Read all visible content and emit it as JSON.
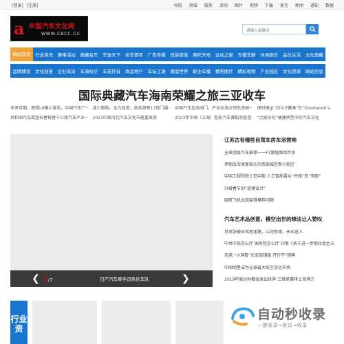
{
  "topbar": {
    "left": [
      "[登录]",
      "[注册]"
    ],
    "right": [
      "导航",
      "商城",
      "服务",
      "活动",
      "图片",
      "视频",
      "下载",
      "留言",
      "新闻",
      "通知",
      "数据"
    ]
  },
  "logo": {
    "title": "中国汽车文化网",
    "url": "WWW.CBCC.CC"
  },
  "search": {
    "placeholder": "请输入关键词"
  },
  "nav_row1": [
    "网站首页",
    "行业资讯",
    "赛事活动",
    "典藏名车",
    "车迷天下",
    "名车荟萃",
    "广告传媒",
    "改装部落",
    "摩托天地",
    "运动之窗",
    "车模艺廊",
    "休闲娱乐",
    "品位生活",
    "文化典藏"
  ],
  "nav_row2": [
    "品牌博览",
    "文化创意",
    "企业风采",
    "车海拾贝",
    "车苑铃音",
    "商品地产",
    "车坛江湖",
    "模型世界",
    "职业车模",
    "精美图片",
    "精彩视频",
    "产业园区",
    "文化资源",
    "网站信息"
  ],
  "headline": "国际典藏汽车海南荣耀之旅三亚收车",
  "sub_links": [
    "未来可期，理想L9爆火背后，中国汽车厂一",
    "减少限购，全力促进，商务部等17部门通一",
    "中国汽车走出国门，产业出海占领先进国一",
    "保时捷gt“GT4 E赛凑”在“Goodwood s-",
    "共和国汽车摇篮长春将建千亿级汽车产业一",
    "2023中国河北汽车文化节隆重显扬",
    "2023年中国（上海）智能汽车赛配及智造一",
    "“泛娱乐化”便捷转型中的汽车文化"
  ],
  "slideshow": {
    "current": "2",
    "total": "/7",
    "caption": "日产汽车牵手迈凯伦车队"
  },
  "news_block1": {
    "title": "江苏古有哪些自驾车房车浴营地",
    "items": [
      "全球顶级汽车赛事一一F1繁殖第四年协",
      "伊朗改军收复家乐宗西部城区新小街区",
      "中国工程院院士范中毅:人工智能要从“并跑”变“领跑”",
      "升级春节的“道德设计”",
      "国航飞机出现装得模样问题"
    ]
  },
  "news_block2": {
    "title": "汽车艺术品创意，模空出世的想法让人赞叹",
    "items": [
      "甘肃张掖自驾者迷路，山河惊魂，天水迷人",
      "中共中央办公厅  国务院办公厅  印发《关于进一步把社会主义",
      "东莞:“小洞看”长安街铺盘  开行不“抱啊",
      "中国明星成为全球最大航空货运市场",
      "2019年高达时都会发出世界  三维竞赛排上海港方"
    ]
  },
  "side_tab": "行业资",
  "watermark": {
    "text": "自动秒收录",
    "sub": "一键收录→来访→收录"
  },
  "colors": {
    "nav_blue": "#1a75cf",
    "active_orange": "#f1a33b",
    "logo_red": "#d8131b"
  }
}
